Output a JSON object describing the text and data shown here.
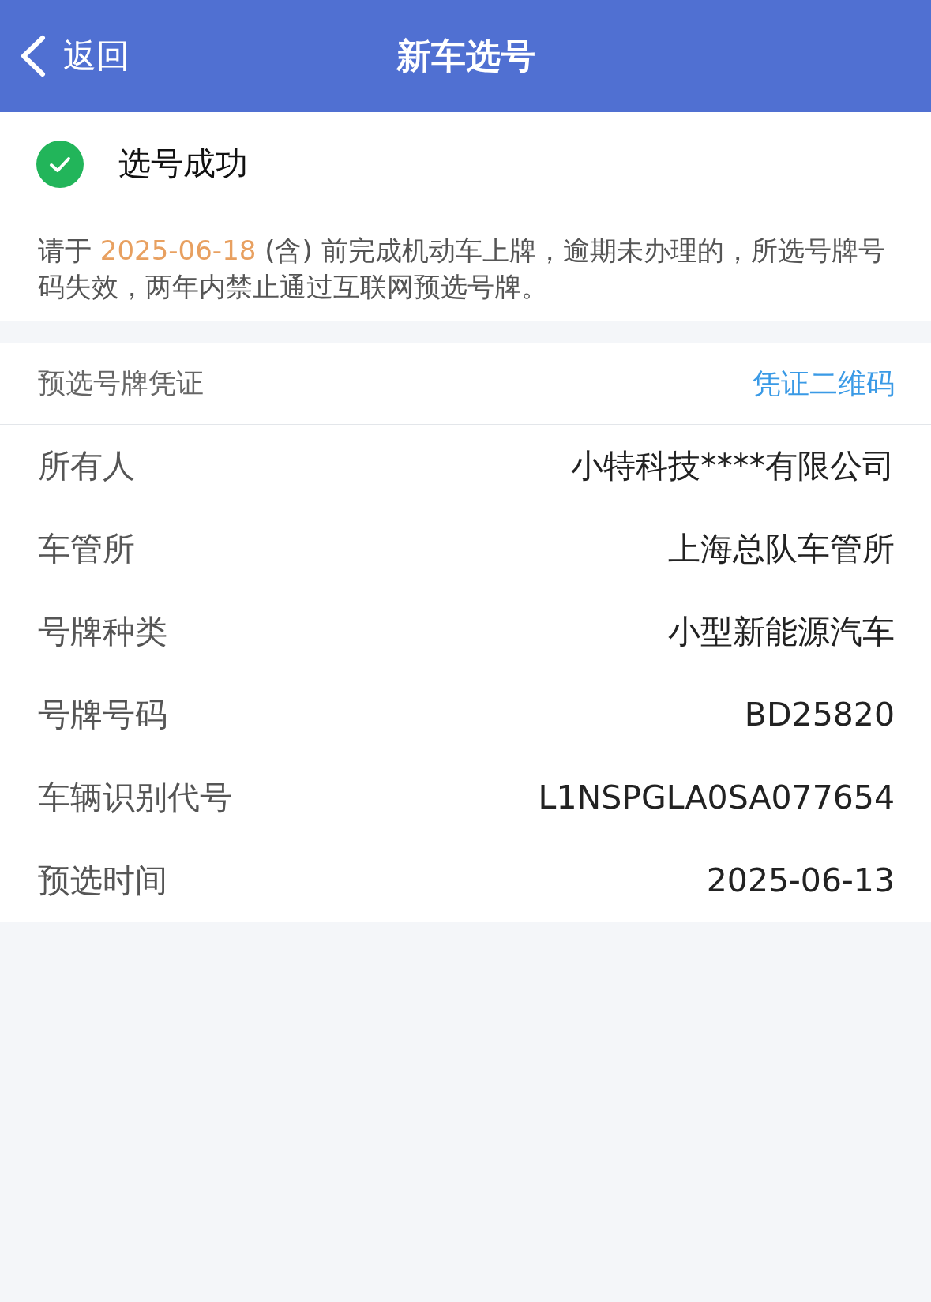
{
  "nav": {
    "back_label": "返回",
    "title": "新车选号"
  },
  "status": {
    "text": "选号成功"
  },
  "notice": {
    "before": "请于",
    "date": "2025-06-18",
    "after": "(含) 前完成机动车上牌，逾期未办理的，所选号牌号码失效，两年内禁止通过互联网预选号牌。"
  },
  "voucher": {
    "title": "预选号牌凭证",
    "link": "凭证二维码"
  },
  "fields": [
    {
      "label": "所有人",
      "value": "小特科技****有限公司"
    },
    {
      "label": "车管所",
      "value": "上海总队车管所"
    },
    {
      "label": "号牌种类",
      "value": "小型新能源汽车"
    },
    {
      "label": "号牌号码",
      "value": "BD25820"
    },
    {
      "label": "车辆识别代号",
      "value": "L1NSPGLA0SA077654"
    },
    {
      "label": "预选时间",
      "value": "2025-06-13"
    }
  ]
}
